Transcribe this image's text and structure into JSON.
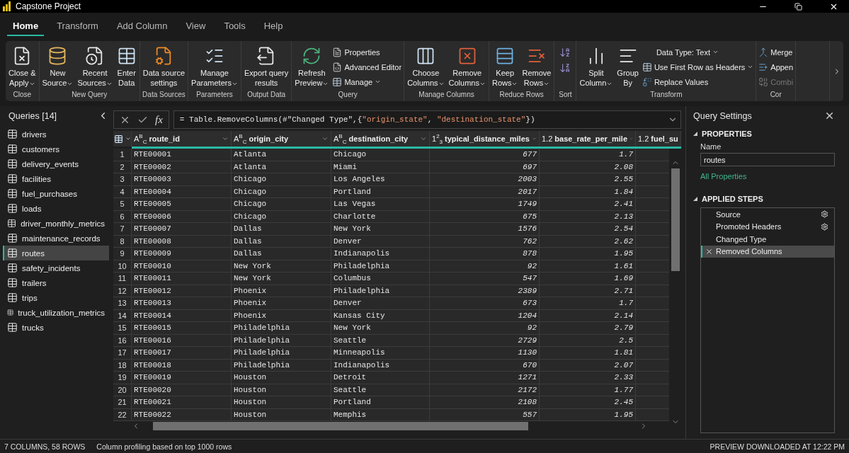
{
  "window": {
    "title": "Capstone Project"
  },
  "tabs": [
    {
      "label": "Home",
      "selected": true
    },
    {
      "label": "Transform",
      "selected": false
    },
    {
      "label": "Add Column",
      "selected": false
    },
    {
      "label": "View",
      "selected": false
    },
    {
      "label": "Tools",
      "selected": false
    },
    {
      "label": "Help",
      "selected": false
    }
  ],
  "ribbon": {
    "groups": [
      {
        "label": "Close",
        "columns": [
          {
            "kind": "large",
            "lines": [
              "Close &",
              "Apply"
            ],
            "dropdown": true
          }
        ]
      },
      {
        "label": "New Query",
        "columns": [
          {
            "kind": "large",
            "lines": [
              "New",
              "Source"
            ],
            "dropdown": true
          },
          {
            "kind": "large",
            "lines": [
              "Recent",
              "Sources"
            ],
            "dropdown": true
          },
          {
            "kind": "large",
            "lines": [
              "Enter",
              "Data"
            ],
            "dropdown": false
          }
        ]
      },
      {
        "label": "Data Sources",
        "columns": [
          {
            "kind": "large",
            "lines": [
              "Data source",
              "settings"
            ],
            "dropdown": false
          }
        ]
      },
      {
        "label": "Parameters",
        "columns": [
          {
            "kind": "large",
            "lines": [
              "Manage",
              "Parameters"
            ],
            "dropdown": true
          }
        ]
      },
      {
        "label": "Output Data",
        "columns": [
          {
            "kind": "large",
            "lines": [
              "Export query",
              "results"
            ],
            "dropdown": false
          }
        ]
      },
      {
        "label": "Query",
        "columns": [
          {
            "kind": "large",
            "lines": [
              "Refresh",
              "Preview"
            ],
            "dropdown": true
          },
          {
            "kind": "stack",
            "items": [
              {
                "kind": "small",
                "label": "Properties",
                "dropdown": false
              },
              {
                "kind": "small",
                "label": "Advanced Editor",
                "dropdown": false
              },
              {
                "kind": "small",
                "label": "Manage",
                "dropdown": true
              }
            ]
          }
        ]
      },
      {
        "label": "Manage Columns",
        "columns": [
          {
            "kind": "large",
            "lines": [
              "Choose",
              "Columns"
            ],
            "dropdown": true
          },
          {
            "kind": "large",
            "lines": [
              "Remove",
              "Columns"
            ],
            "dropdown": true
          }
        ]
      },
      {
        "label": "Reduce Rows",
        "columns": [
          {
            "kind": "large",
            "lines": [
              "Keep",
              "Rows"
            ],
            "dropdown": true
          },
          {
            "kind": "large",
            "lines": [
              "Remove",
              "Rows"
            ],
            "dropdown": true
          }
        ]
      },
      {
        "label": "Sort",
        "columns": [
          {
            "kind": "stack",
            "items": [
              {
                "kind": "icon"
              },
              {
                "kind": "icon"
              }
            ]
          }
        ]
      },
      {
        "label": "Transform",
        "columns": [
          {
            "kind": "large",
            "lines": [
              "Split",
              "Column"
            ],
            "dropdown": true
          },
          {
            "kind": "large",
            "lines": [
              "Group",
              "By"
            ],
            "dropdown": false
          },
          {
            "kind": "stack",
            "items": [
              {
                "kind": "menu",
                "label": "Data Type: Text",
                "dropdown": true
              },
              {
                "kind": "small",
                "label": "Use First Row as Headers",
                "dropdown": true
              },
              {
                "kind": "small",
                "label": "Replace Values",
                "dropdown": false
              }
            ]
          }
        ]
      },
      {
        "label": "Cor",
        "columns": [
          {
            "kind": "stack",
            "items": [
              {
                "kind": "small",
                "label": "Merge",
                "dropdown": false,
                "disabled": false
              },
              {
                "kind": "small",
                "label": "Appen",
                "dropdown": false,
                "disabled": false
              },
              {
                "kind": "small",
                "label": "Combi",
                "dropdown": false,
                "disabled": true
              }
            ]
          }
        ]
      }
    ]
  },
  "queries": {
    "title": "Queries [14]",
    "items": [
      {
        "label": "drivers",
        "selected": false
      },
      {
        "label": "customers",
        "selected": false
      },
      {
        "label": "delivery_events",
        "selected": false
      },
      {
        "label": "facilities",
        "selected": false
      },
      {
        "label": "fuel_purchases",
        "selected": false
      },
      {
        "label": "loads",
        "selected": false
      },
      {
        "label": "driver_monthly_metrics",
        "selected": false
      },
      {
        "label": "maintenance_records",
        "selected": false
      },
      {
        "label": "routes",
        "selected": true
      },
      {
        "label": "safety_incidents",
        "selected": false
      },
      {
        "label": "trailers",
        "selected": false
      },
      {
        "label": "trips",
        "selected": false
      },
      {
        "label": "truck_utilization_metrics",
        "selected": false
      },
      {
        "label": "trucks",
        "selected": false
      }
    ]
  },
  "formula_bar": {
    "fx": "fx",
    "segments": [
      {
        "kind": "plain",
        "text": "= Table.RemoveColumns(#\"Changed Type\",{"
      },
      {
        "kind": "string",
        "text": "\"origin_state\""
      },
      {
        "kind": "plain",
        "text": ", "
      },
      {
        "kind": "string",
        "text": "\"destination_state\""
      },
      {
        "kind": "plain",
        "text": "})"
      }
    ]
  },
  "table": {
    "columns": [
      {
        "type_label": "A$^{B}$$_{C}$",
        "name": "route_id",
        "kind": "text"
      },
      {
        "type_label": "A$^{B}$$_{C}$",
        "name": "origin_city",
        "kind": "text"
      },
      {
        "type_label": "A$^{B}$$_{C}$",
        "name": "destination_city",
        "kind": "text"
      },
      {
        "type_label": "1$^{2}$$_{3}$",
        "name": "typical_distance_miles",
        "kind": "number"
      },
      {
        "type_label": "1.2",
        "name": "base_rate_per_mile",
        "kind": "number"
      },
      {
        "type_label": "1.2",
        "name": "fuel_su"
      }
    ],
    "rows": [
      {
        "n": "1",
        "cells": [
          "RTE00001",
          "Atlanta",
          "Chicago",
          "677",
          "1.7"
        ]
      },
      {
        "n": "2",
        "cells": [
          "RTE00002",
          "Atlanta",
          "Miami",
          "697",
          "2.08"
        ]
      },
      {
        "n": "3",
        "cells": [
          "RTE00003",
          "Chicago",
          "Los Angeles",
          "2003",
          "2.55"
        ]
      },
      {
        "n": "4",
        "cells": [
          "RTE00004",
          "Chicago",
          "Portland",
          "2017",
          "1.84"
        ]
      },
      {
        "n": "5",
        "cells": [
          "RTE00005",
          "Chicago",
          "Las Vegas",
          "1749",
          "2.41"
        ]
      },
      {
        "n": "6",
        "cells": [
          "RTE00006",
          "Chicago",
          "Charlotte",
          "675",
          "2.13"
        ]
      },
      {
        "n": "7",
        "cells": [
          "RTE00007",
          "Dallas",
          "New York",
          "1576",
          "2.54"
        ]
      },
      {
        "n": "8",
        "cells": [
          "RTE00008",
          "Dallas",
          "Denver",
          "762",
          "2.62"
        ]
      },
      {
        "n": "9",
        "cells": [
          "RTE00009",
          "Dallas",
          "Indianapolis",
          "878",
          "1.95"
        ]
      },
      {
        "n": "10",
        "cells": [
          "RTE00010",
          "New York",
          "Philadelphia",
          "92",
          "1.61"
        ]
      },
      {
        "n": "11",
        "cells": [
          "RTE00011",
          "New York",
          "Columbus",
          "547",
          "1.69"
        ]
      },
      {
        "n": "12",
        "cells": [
          "RTE00012",
          "Phoenix",
          "Philadelphia",
          "2389",
          "2.71"
        ]
      },
      {
        "n": "13",
        "cells": [
          "RTE00013",
          "Phoenix",
          "Denver",
          "673",
          "1.7"
        ]
      },
      {
        "n": "14",
        "cells": [
          "RTE00014",
          "Phoenix",
          "Kansas City",
          "1204",
          "2.14"
        ]
      },
      {
        "n": "15",
        "cells": [
          "RTE00015",
          "Philadelphia",
          "New York",
          "92",
          "2.79"
        ]
      },
      {
        "n": "16",
        "cells": [
          "RTE00016",
          "Philadelphia",
          "Seattle",
          "2729",
          "2.5"
        ]
      },
      {
        "n": "17",
        "cells": [
          "RTE00017",
          "Philadelphia",
          "Minneapolis",
          "1130",
          "1.81"
        ]
      },
      {
        "n": "18",
        "cells": [
          "RTE00018",
          "Philadelphia",
          "Indianapolis",
          "670",
          "2.07"
        ]
      },
      {
        "n": "19",
        "cells": [
          "RTE00019",
          "Houston",
          "Detroit",
          "1271",
          "2.33"
        ]
      },
      {
        "n": "20",
        "cells": [
          "RTE00020",
          "Houston",
          "Seattle",
          "2172",
          "1.77"
        ]
      },
      {
        "n": "21",
        "cells": [
          "RTE00021",
          "Houston",
          "Portland",
          "2108",
          "2.45"
        ]
      },
      {
        "n": "22",
        "cells": [
          "RTE00022",
          "Houston",
          "Memphis",
          "557",
          "1.95"
        ]
      }
    ]
  },
  "query_settings": {
    "title": "Query Settings",
    "properties_heading": "PROPERTIES",
    "name_label": "Name",
    "name_value": "routes",
    "all_properties_link": "All Properties",
    "steps_heading": "APPLIED STEPS",
    "steps": [
      {
        "label": "Source",
        "settings": true,
        "selected": false
      },
      {
        "label": "Promoted Headers",
        "settings": true,
        "selected": false
      },
      {
        "label": "Changed Type",
        "settings": false,
        "selected": false
      },
      {
        "label": "Removed Columns",
        "settings": false,
        "selected": true
      }
    ]
  },
  "status_bar": {
    "summary": "7 COLUMNS, 58 ROWS",
    "profiling": "Column profiling based on top 1000 rows",
    "preview": "PREVIEW DOWNLOADED AT 12:22 PM"
  }
}
